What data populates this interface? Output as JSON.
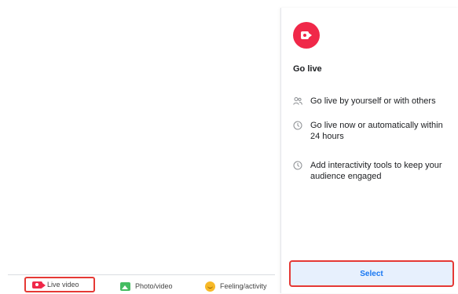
{
  "composer": {
    "live_label": "Live video",
    "photo_label": "Photo/video",
    "feeling_label": "Feeling/activity"
  },
  "panel": {
    "title": "Go live",
    "features": [
      "Go live by yourself or with others",
      "Go live now or automatically within 24 hours",
      "Add interactivity tools to keep your audience engaged"
    ],
    "select_label": "Select"
  },
  "colors": {
    "live_red": "#f02849",
    "highlight_red": "#e53935",
    "accent_blue": "#1877f2",
    "select_bg": "#e7f0fd"
  }
}
